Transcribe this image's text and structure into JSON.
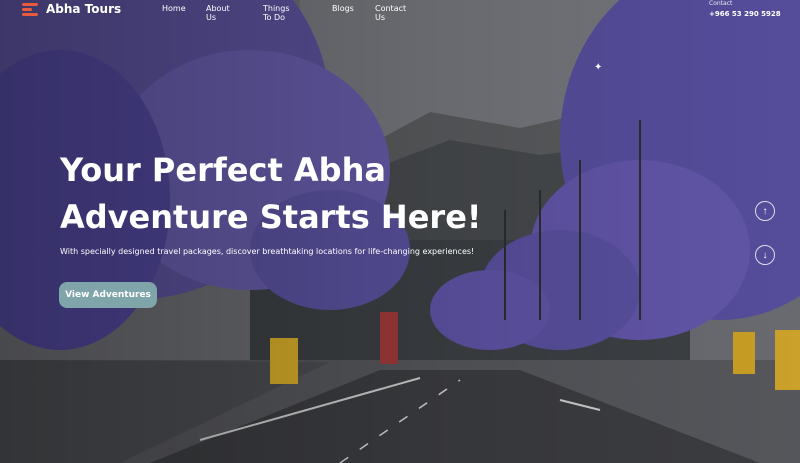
{
  "brand": {
    "name": "Abha Tours",
    "accent": "#e85a3c"
  },
  "nav": {
    "items": [
      {
        "label": "Home"
      },
      {
        "label": "About Us"
      },
      {
        "label": "Things To Do"
      },
      {
        "label": "Blogs"
      },
      {
        "label": "Contact Us"
      }
    ]
  },
  "contact": {
    "label": "Contact",
    "phone": "+966 53 290 5928"
  },
  "hero": {
    "title_line1": "Your Perfect Abha",
    "title_line2": "Adventure Starts Here!",
    "subtitle": "With specially designed travel packages, discover breathtaking locations for life-changing experiences!",
    "cta_label": "View Adventures",
    "cta_color": "#7fa4aa"
  },
  "scroll": {
    "up_icon": "arrow-up-icon",
    "down_icon": "arrow-down-icon"
  }
}
